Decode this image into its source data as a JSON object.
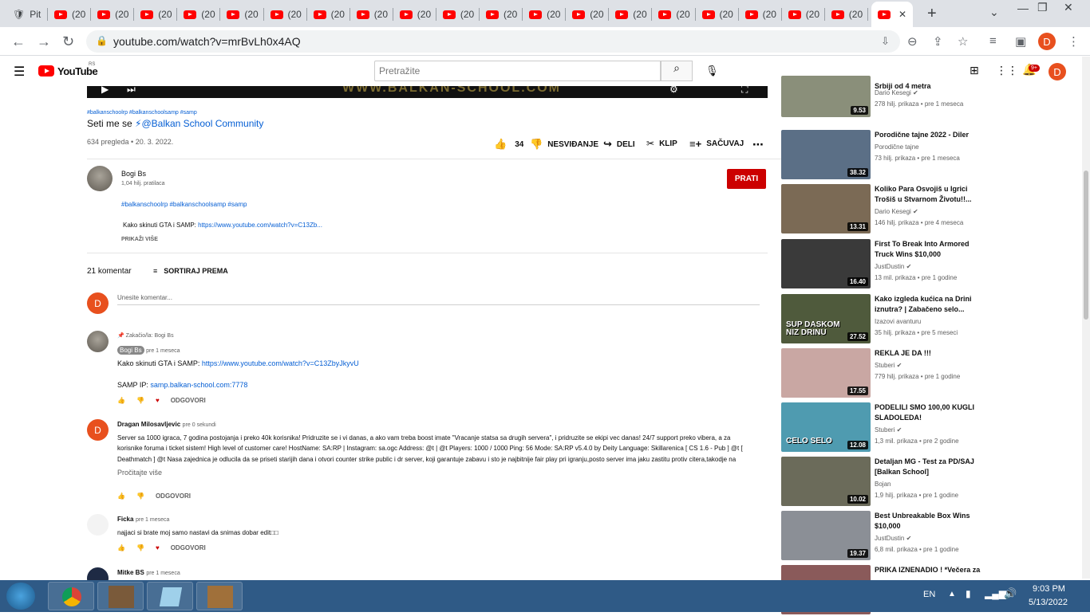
{
  "browser": {
    "tabs": [
      {
        "title": "Pit"
      },
      {
        "title": "(20"
      },
      {
        "title": "(20"
      },
      {
        "title": "(20"
      },
      {
        "title": "(20"
      },
      {
        "title": "(20"
      },
      {
        "title": "(20"
      },
      {
        "title": "(20"
      },
      {
        "title": "(20"
      },
      {
        "title": "(20"
      },
      {
        "title": "(20"
      },
      {
        "title": "(20"
      },
      {
        "title": "(20"
      },
      {
        "title": "(20"
      },
      {
        "title": "(20"
      },
      {
        "title": "(20"
      },
      {
        "title": "(20"
      },
      {
        "title": "(20"
      },
      {
        "title": "(20"
      },
      {
        "title": "(20"
      },
      {
        "title": "(20"
      }
    ],
    "url": "youtube.com/watch?v=mrBvLh0x4AQ",
    "profile_initial": "D"
  },
  "youtube": {
    "logo_text": "YouTube",
    "country": "RS",
    "search_placeholder": "Pretražite",
    "notif_count": "9+",
    "avatar_initial": "D"
  },
  "video": {
    "tags": "#balkanschoolrp #balkanschoolsamp #samp",
    "title_prefix": "Seti me se ",
    "title_link": "⚡@Balkan School Community",
    "views_date": "634 pregleda • 20. 3. 2022.",
    "likes": "34",
    "dislike": "NESVIĐANJE",
    "share": "DELI",
    "clip": "KLIP",
    "save": "SAČUVAJ"
  },
  "channel": {
    "name": "Bogi Bs",
    "subs": "1,04 hilj. pratilaca",
    "subscribe": "PRATI",
    "desc_tags": "#balkanschoolrp #balkanschoolsamp #samp",
    "desc_line_prefix": "Kako skinuti GTA i SAMP: ",
    "desc_link": "https://www.youtube.com/watch?v=C13Zb...",
    "show_more": "PRIKAŽI VIŠE"
  },
  "comments_header": {
    "count": "21 komentar",
    "sort": "SORTIRAJ PREMA",
    "add_placeholder": "Unesite komentar...",
    "avatar_initial": "D"
  },
  "comments": [
    {
      "pinned": "Zakačio/la: Bogi Bs",
      "author": "Bogi Bs",
      "time": "pre 1 meseca",
      "line1_prefix": "Kako skinuti GTA i SAMP: ",
      "line1_link": "https://www.youtube.com/watch?v=C13ZbyJkyvU",
      "line2_prefix": "SAMP IP: ",
      "line2_link": "samp.balkan-school.com:7778",
      "reply": "ODGOVORI"
    },
    {
      "author": "Dragan Milosavljevic",
      "time": "pre 0 sekundi",
      "avatar_initial": "D",
      "text": "Server sa 1000 igraca, 7 godina postojanja i preko 40k korisnika! Pridruzite se i vi danas, a ako vam treba boost imate \"Vracanje statsa sa drugih servera\", i pridruzite se ekipi vec danas! 24/7 support preko vibera, a za korisnike foruma i ticket sistem! High level of customer care! HostName: SA:RP | Instagram: sa.ogc Address: @t | @t Players: 1000 / 1000 Ping: 56 Mode: SA:RP v5.4.0 by Deity Language: Skillarenica [ CS 1.6 - Pub ] @t [ Deathmatch ] @t Nasa zajednica je odlucila da se priseti starijih dana i otvori counter strike public i dr server, koji garantuje zabavu i sto je najbitnije fair play pri igranju,posto server ima jaku zastitu protiv citera,takodje na serveru ima aktivnih admina,tako da je zabava na ovom serveru zagarantovana. [ TS3 ] @t Ono sto cini ...",
      "read_more": "Pročitajte više",
      "reply": "ODGOVORI"
    },
    {
      "author": "Ficka",
      "time": "pre 1 meseca",
      "text": "najjaci si brate moj samo nastavi da snimas dobar edit□□",
      "reply": "ODGOVORI"
    },
    {
      "author": "Mitke BS",
      "time": "pre 1 meseca"
    }
  ],
  "sidebar": [
    {
      "title": "Srbiji od 4 metra",
      "channel": "Dario Kesegi",
      "verified": true,
      "meta": "278 hilj. prikaza • pre 1 meseca",
      "duration": "9.53",
      "color": "#8a8f7a"
    },
    {
      "title": "Porodične tajne 2022 - Diler",
      "channel": "Porodične tajne",
      "verified": false,
      "meta": "73 hilj. prikaza • pre 1 meseca",
      "duration": "38.32",
      "color": "#5b6f86"
    },
    {
      "title": "Koliko Para Osvojiš u Igrici Trošiš u Stvarnom Životu!!...",
      "channel": "Dario Kesegi",
      "verified": true,
      "meta": "146 hilj. prikaza • pre 4 meseca",
      "duration": "13.31",
      "color": "#7b6a55"
    },
    {
      "title": "First To Break Into Armored Truck Wins $10,000",
      "channel": "JustDustin",
      "verified": true,
      "meta": "13 mil. prikaza • pre 1 godine",
      "duration": "16.40",
      "color": "#3a3a3a"
    },
    {
      "title": "Kako izgleda kućica na Drini iznutra? | Zabačeno selo...",
      "channel": "Izazovi avanturu",
      "verified": false,
      "meta": "35 hilj. prikaza • pre 5 meseci",
      "duration": "27.52",
      "color": "#4f5a3c",
      "overlay": "SUP DASKOM NIZ DRINU"
    },
    {
      "title": "REKLA JE DA !!!",
      "channel": "Stuberi",
      "verified": true,
      "meta": "779 hilj. prikaza • pre 1 godine",
      "duration": "17.55",
      "color": "#c9a7a3"
    },
    {
      "title": "PODELILI SMO 100,00 KUGLI SLADOLEDA!",
      "channel": "Stuberi",
      "verified": true,
      "meta": "1,3 mil. prikaza • pre 2 godine",
      "duration": "12.08",
      "color": "#4f9bb0",
      "overlay": "CELO SELO"
    },
    {
      "title": "Detaljan MG - Test za PD/SAJ [Balkan School]",
      "channel": "Bojan",
      "verified": false,
      "meta": "1,9 hilj. prikaza • pre 1 godine",
      "duration": "10.02",
      "color": "#6b6b5a"
    },
    {
      "title": "Best Unbreakable Box Wins $10,000",
      "channel": "JustDustin",
      "verified": true,
      "meta": "6,8 mil. prikaza • pre 1 godine",
      "duration": "19.37",
      "color": "#8b8f96"
    },
    {
      "title": "PRIKA IZNENADIO ! *Večera za",
      "channel": "",
      "verified": false,
      "meta": "",
      "duration": "",
      "color": "#8a5a5a"
    }
  ],
  "taskbar": {
    "lang": "EN",
    "time": "9:03 PM",
    "date": "5/13/2022"
  }
}
